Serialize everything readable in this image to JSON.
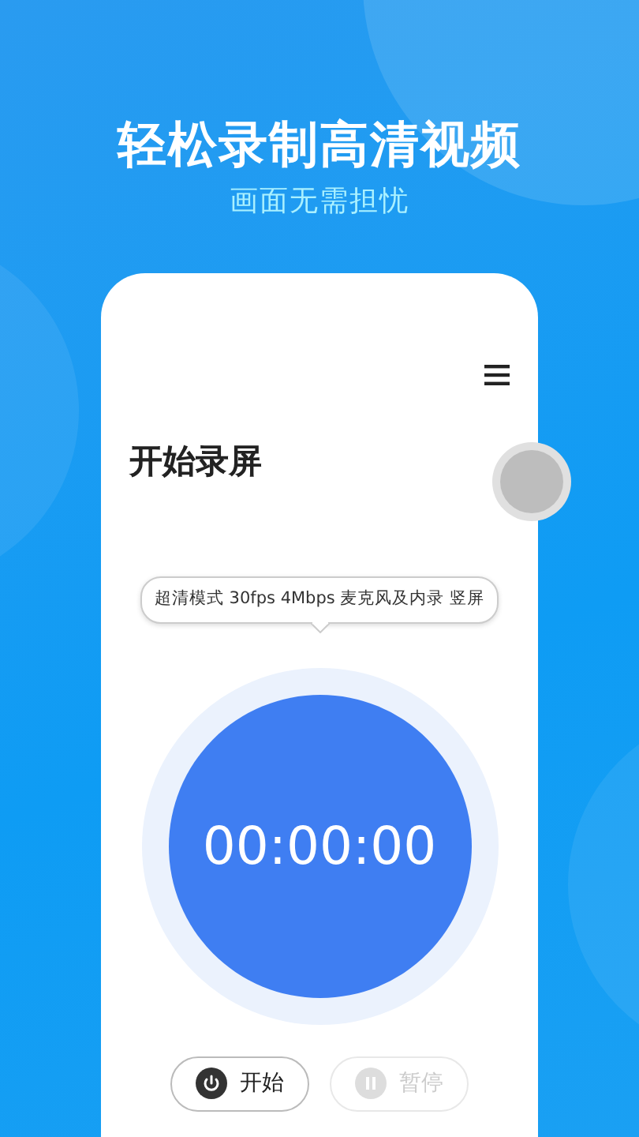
{
  "headline": "轻松录制高清视频",
  "subtitle": "画面无需担忧",
  "app": {
    "title": "开始录屏",
    "mode_tip": "超清模式 30fps 4Mbps 麦克风及内录 竖屏",
    "timer": "00:00:00",
    "buttons": [
      {
        "kind": "start",
        "label": "开始",
        "disabled": false
      },
      {
        "kind": "pause",
        "label": "暂停",
        "disabled": true
      }
    ]
  }
}
